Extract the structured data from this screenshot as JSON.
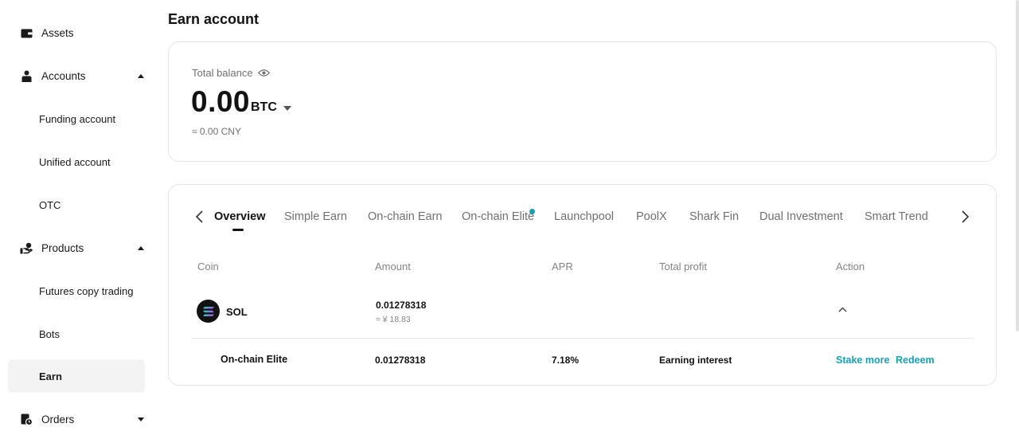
{
  "sidebar": {
    "assets": "Assets",
    "accounts": "Accounts",
    "funding": "Funding account",
    "unified": "Unified account",
    "otc": "OTC",
    "products": "Products",
    "copy_trading": "Futures copy trading",
    "bots": "Bots",
    "earn": "Earn",
    "orders": "Orders"
  },
  "page": {
    "title": "Earn account"
  },
  "balance": {
    "label": "Total balance",
    "value": "0.00",
    "unit": "BTC",
    "fiat": "≈ 0.00 CNY"
  },
  "tabs": [
    {
      "label": "Overview"
    },
    {
      "label": "Simple Earn"
    },
    {
      "label": "On-chain Earn"
    },
    {
      "label": "On-chain Elite"
    },
    {
      "label": "Launchpool"
    },
    {
      "label": "PoolX"
    },
    {
      "label": "Shark Fin"
    },
    {
      "label": "Dual Investment"
    },
    {
      "label": "Smart Trend"
    }
  ],
  "table": {
    "headers": {
      "coin": "Coin",
      "amount": "Amount",
      "apr": "APR",
      "profit": "Total profit",
      "action": "Action"
    },
    "row": {
      "coin": "SOL",
      "amount": "0.01278318",
      "amount_fiat": "≈ ¥ 18.83"
    },
    "sub_row": {
      "product": "On-chain Elite",
      "amount": "0.01278318",
      "apr": "7.18%",
      "profit": "Earning interest",
      "stake_more": "Stake more",
      "redeem": "Redeem"
    }
  },
  "colors": {
    "accent": "#18a0b4",
    "text": "#121212",
    "muted": "#707070"
  }
}
